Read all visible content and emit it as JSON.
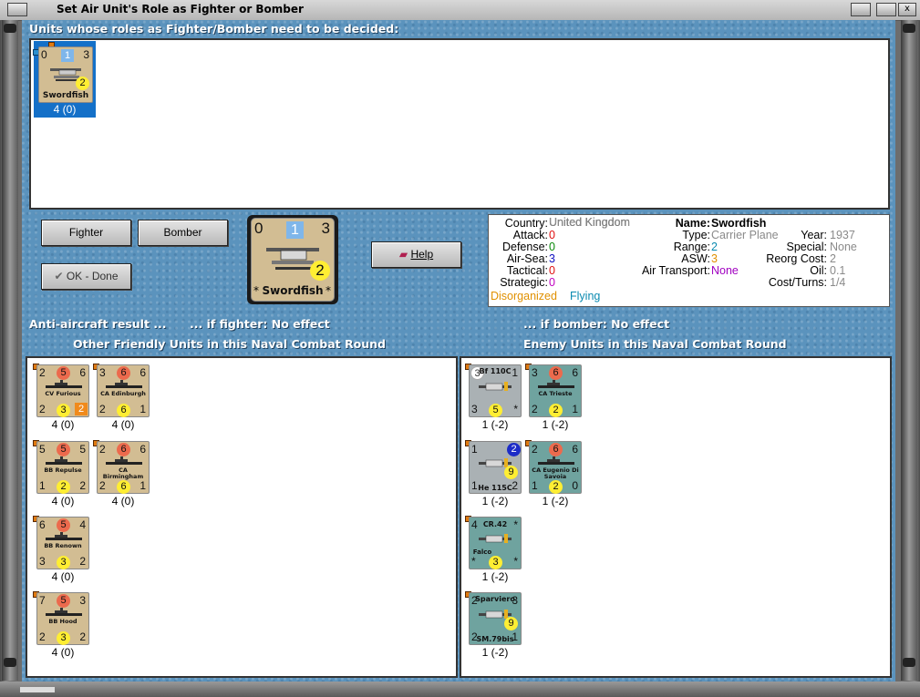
{
  "window": {
    "title": "Set Air Unit's Role as Fighter or Bomber"
  },
  "headers": {
    "undecided": "Units whose roles as Fighter/Bomber need to be decided:",
    "aa_result": "Anti-aircraft result ...",
    "if_fighter": "... if fighter:  No effect",
    "if_bomber": "... if bomber:  No effect",
    "friendly": "Other Friendly Units in this Naval Combat Round",
    "enemy": "Enemy Units in this Naval Combat Round"
  },
  "buttons": {
    "fighter": "Fighter",
    "bomber": "Bomber",
    "ok": "OK - Done",
    "help": "Help"
  },
  "selected_unit": {
    "name": "Swordfish",
    "tl": "0",
    "top_num": "1",
    "tr": "3",
    "circle": "2",
    "under": "4 (0)"
  },
  "big_counter": {
    "name": "Swordfish",
    "tl": "0",
    "top_num": "1",
    "tr": "3",
    "circle": "2",
    "star_l": "*",
    "star_r": "*"
  },
  "info": {
    "country_l": "Country:",
    "country_v": "United Kingdom",
    "attack_l": "Attack:",
    "attack_v": "0",
    "defense_l": "Defense:",
    "defense_v": "0",
    "airsea_l": "Air-Sea:",
    "airsea_v": "3",
    "tactical_l": "Tactical:",
    "tactical_v": "0",
    "strategic_l": "Strategic:",
    "strategic_v": "0",
    "status1": "Disorganized",
    "status2": "Flying",
    "name_l": "Name:",
    "name_v": "Swordfish",
    "type_l": "Type:",
    "type_v": "Carrier Plane",
    "year_l": "Year:",
    "year_v": "1937",
    "range_l": "Range:",
    "range_v": "2",
    "special_l": "Special:",
    "special_v": "None",
    "asw_l": "ASW:",
    "asw_v": "3",
    "reorg_l": "Reorg Cost:",
    "reorg_v": "2",
    "airtrans_l": "Air Transport:",
    "airtrans_v": "None",
    "oil_l": "Oil:",
    "oil_v": "0.1",
    "cost_l": "Cost/Turns:",
    "cost_v": "1/4"
  },
  "friendly_units": [
    {
      "name": "CV Furious",
      "tl": "2",
      "dot": "5",
      "tr": "6",
      "bl": "2",
      "yel": "3",
      "br": "2",
      "br_style": "orange",
      "under": "4 (0)"
    },
    {
      "name": "CA Edinburgh",
      "tl": "3",
      "dot": "6",
      "tr": "6",
      "bl": "2",
      "yel": "6",
      "br": "1",
      "under": "4 (0)"
    },
    {
      "name": "BB Repulse",
      "tl": "5",
      "dot": "5",
      "tr": "5",
      "bl": "1",
      "yel": "2",
      "br": "2",
      "under": "4 (0)"
    },
    {
      "name": "CA Birmingham",
      "tl": "2",
      "dot": "6",
      "tr": "6",
      "bl": "2",
      "yel": "6",
      "br": "1",
      "under": "4 (0)"
    },
    {
      "name": "BB Renown",
      "tl": "6",
      "dot": "5",
      "tr": "4",
      "bl": "3",
      "yel": "3",
      "br": "2",
      "under": "4 (0)"
    },
    {
      "name": "BB Hood",
      "tl": "7",
      "dot": "5",
      "tr": "3",
      "bl": "2",
      "yel": "3",
      "br": "2",
      "under": "4 (0)"
    }
  ],
  "enemy_units": [
    {
      "name": "Bf 110C",
      "tl": "3",
      "tr": "1",
      "bl": "3",
      "yel": "5",
      "br": "*",
      "under": "1 (-2)"
    },
    {
      "name": "CA Trieste",
      "tl": "3",
      "dot": "6",
      "tr": "6",
      "bl": "2",
      "yel": "2",
      "br": "1",
      "under": "1 (-2)"
    },
    {
      "name": "He 115C",
      "tl": "1",
      "blue": "2",
      "yel": "9",
      "bl": "1",
      "br": "2",
      "under": "1 (-2)"
    },
    {
      "name": "CA Eugenio Di Savoia",
      "tl": "2",
      "dot": "6",
      "tr": "6",
      "bl": "1",
      "yel": "2",
      "br": "0",
      "under": "1 (-2)"
    },
    {
      "name": "CR.42",
      "sub": "Falco",
      "tl": "4",
      "tr": "*",
      "bl": "*",
      "yel": "3",
      "br": "*",
      "under": "1 (-2)"
    },
    {
      "name": "SM.79bis",
      "sub": "Sparviero",
      "tl": "2",
      "tr": "3",
      "bl": "2",
      "yel": "9",
      "br": "1",
      "under": "1 (-2)"
    }
  ]
}
